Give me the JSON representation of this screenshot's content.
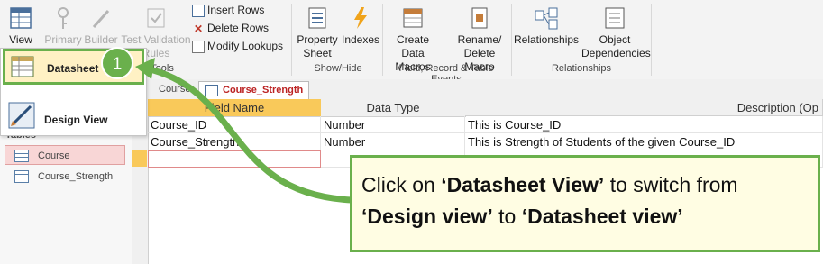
{
  "ribbon": {
    "view_label": "View",
    "primary_key_label": "Primary Key",
    "builder_label": "Builder",
    "test_validation_label": "Test Validation Rules",
    "insert_rows_label": "Insert Rows",
    "delete_rows_label": "Delete Rows",
    "modify_lookups_label": "Modify Lookups",
    "tools_group_label": "Tools",
    "property_sheet_label": "Property Sheet",
    "indexes_label": "Indexes",
    "show_hide_group_label": "Show/Hide",
    "create_data_macros_label": "Create Data Macros",
    "rename_delete_macro_label": "Rename/ Delete Macro",
    "field_events_group_label": "Field, Record & Table Events",
    "relationships_label": "Relationships",
    "object_dependencies_label": "Object Dependencies",
    "relationships_group_label": "Relationships"
  },
  "view_menu": {
    "datasheet_view_label": "Datasheet View",
    "design_view_label": "Design View"
  },
  "nav": {
    "header": "Tables",
    "items": [
      {
        "label": "Course",
        "selected": true
      },
      {
        "label": "Course_Strength",
        "selected": false
      }
    ]
  },
  "tabs": [
    {
      "label": "Course",
      "active": false
    },
    {
      "label": "Course_Strength",
      "active": true
    }
  ],
  "grid": {
    "headers": [
      "Field Name",
      "Data Type",
      "Description (Op"
    ],
    "rows": [
      {
        "field_name": "Course_ID",
        "data_type": "Number",
        "description": "This is Course_ID"
      },
      {
        "field_name": "Course_Strength",
        "data_type": "Number",
        "description": "This is Strength of Students of the given Course_ID"
      }
    ]
  },
  "callout": {
    "step_number": "1",
    "line1_prefix": "Click on ",
    "line1_bold": "‘Datasheet View’",
    "line1_suffix": " to switch from",
    "line2_bold1": "‘Design view’",
    "line2_mid": " to ",
    "line2_bold2": "‘Datasheet view’"
  },
  "colors": {
    "accent_green": "#6ab04c",
    "header_selected": "#f9c95a",
    "callout_bg": "#fffde3",
    "nav_selected_bg": "#f8d6d6"
  }
}
